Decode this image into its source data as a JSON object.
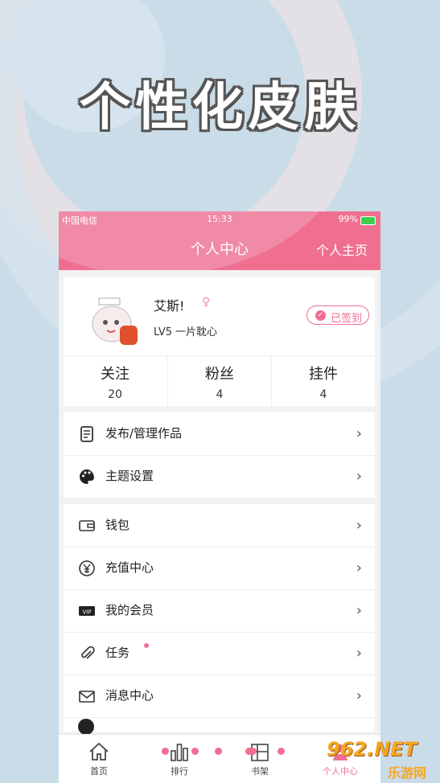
{
  "headline": "个性化皮肤",
  "status_bar": {
    "left": "中国电信",
    "time": "15:33",
    "battery": "99%"
  },
  "header": {
    "title": "个人中心",
    "home_link": "个人主页"
  },
  "profile": {
    "name": "艾斯!",
    "gender_icon": "female-icon",
    "level": "LV5 一片耽心",
    "signed_label": "已签到"
  },
  "stats": [
    {
      "label": "关注",
      "value": "20"
    },
    {
      "label": "粉丝",
      "value": "4"
    },
    {
      "label": "挂件",
      "value": "4"
    }
  ],
  "menu_group1": [
    {
      "label": "发布/管理作品",
      "icon": "document-icon"
    },
    {
      "label": "主题设置",
      "icon": "palette-icon"
    }
  ],
  "menu_group2": [
    {
      "label": "钱包",
      "icon": "wallet-icon"
    },
    {
      "label": "充值中心",
      "icon": "yen-icon"
    },
    {
      "label": "我的会员",
      "icon": "vip-icon"
    },
    {
      "label": "任务",
      "icon": "paperclip-icon"
    },
    {
      "label": "消息中心",
      "icon": "mail-icon"
    }
  ],
  "tabbar": [
    {
      "label": "首页",
      "icon": "home-icon"
    },
    {
      "label": "排行",
      "icon": "ranking-icon"
    },
    {
      "label": "书架",
      "icon": "bookshelf-icon"
    },
    {
      "label": "个人中心",
      "icon": "user-icon"
    }
  ],
  "watermark": {
    "main": "962.NET",
    "sub": "乐游网"
  },
  "colors": {
    "accent": "#f06f91",
    "background": "#c9dce8"
  }
}
